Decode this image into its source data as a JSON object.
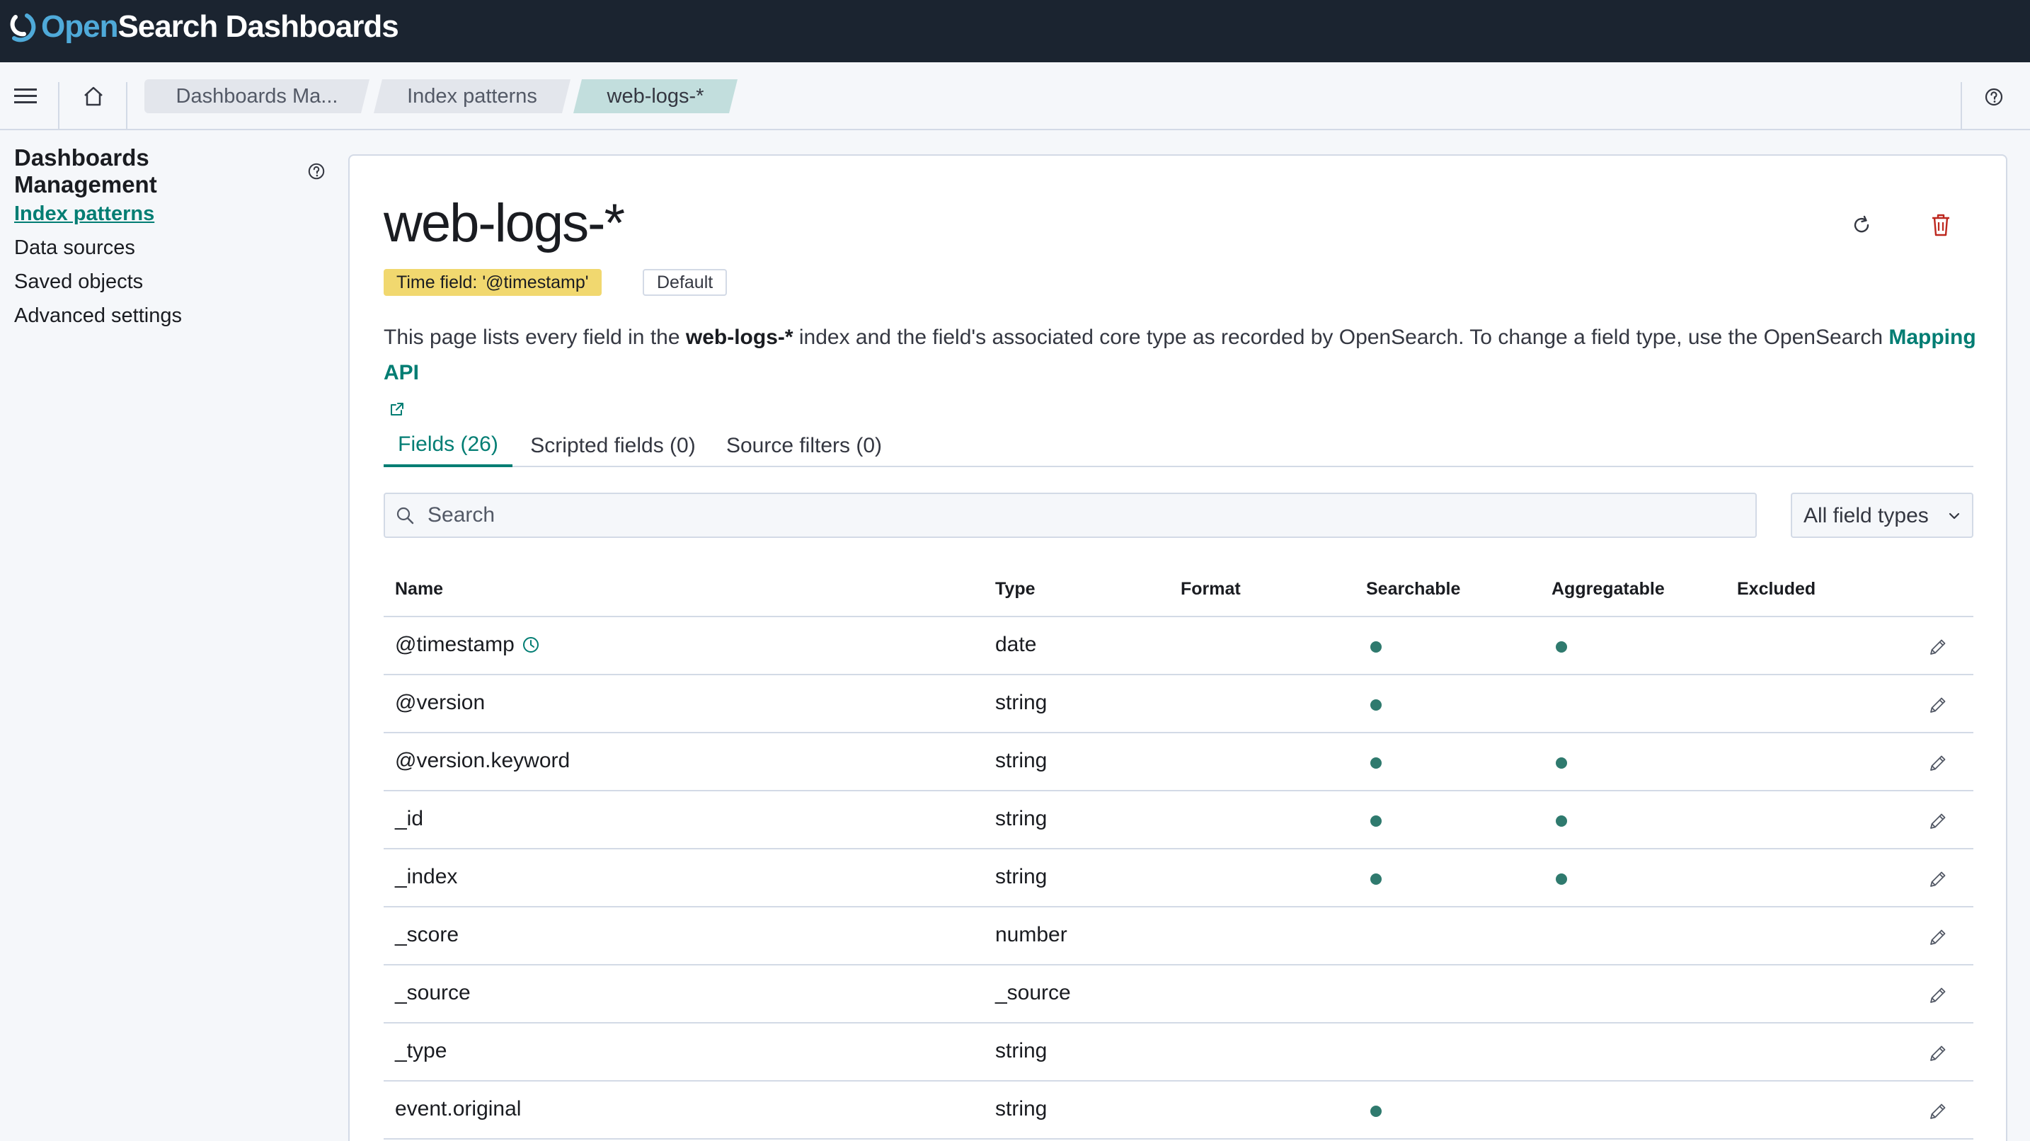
{
  "app": {
    "logo_part1": "Open",
    "logo_part2": "Search Dashboards"
  },
  "breadcrumbs": [
    "Dashboards Ma...",
    "Index patterns",
    "web-logs-*"
  ],
  "sidenav": {
    "title": "Dashboards Management",
    "items": [
      {
        "label": "Index patterns",
        "active": true
      },
      {
        "label": "Data sources",
        "active": false
      },
      {
        "label": "Saved objects",
        "active": false
      },
      {
        "label": "Advanced settings",
        "active": false
      }
    ]
  },
  "page": {
    "title": "web-logs-*",
    "badge_time": "Time field: '@timestamp'",
    "badge_default": "Default",
    "desc_part1": "This page lists every field in the ",
    "desc_bold": "web-logs-*",
    "desc_part2": " index and the field's associated core type as recorded by OpenSearch. To change a field type, use the OpenSearch ",
    "desc_link": "Mapping API"
  },
  "tabs": [
    "Fields (26)",
    "Scripted fields (0)",
    "Source filters (0)"
  ],
  "search": {
    "placeholder": "Search",
    "value": ""
  },
  "filter": {
    "selected": "All field types"
  },
  "table": {
    "headers": {
      "name": "Name",
      "type": "Type",
      "format": "Format",
      "searchable": "Searchable",
      "aggregatable": "Aggregatable",
      "excluded": "Excluded"
    },
    "rows": [
      {
        "name": "@timestamp",
        "type": "date",
        "format": "",
        "searchable": true,
        "aggregatable": true,
        "excluded": false,
        "time_field": true
      },
      {
        "name": "@version",
        "type": "string",
        "format": "",
        "searchable": true,
        "aggregatable": false,
        "excluded": false
      },
      {
        "name": "@version.keyword",
        "type": "string",
        "format": "",
        "searchable": true,
        "aggregatable": true,
        "excluded": false
      },
      {
        "name": "_id",
        "type": "string",
        "format": "",
        "searchable": true,
        "aggregatable": true,
        "excluded": false
      },
      {
        "name": "_index",
        "type": "string",
        "format": "",
        "searchable": true,
        "aggregatable": true,
        "excluded": false
      },
      {
        "name": "_score",
        "type": "number",
        "format": "",
        "searchable": false,
        "aggregatable": false,
        "excluded": false
      },
      {
        "name": "_source",
        "type": "_source",
        "format": "",
        "searchable": false,
        "aggregatable": false,
        "excluded": false
      },
      {
        "name": "_type",
        "type": "string",
        "format": "",
        "searchable": false,
        "aggregatable": false,
        "excluded": false
      },
      {
        "name": "event.original",
        "type": "string",
        "format": "",
        "searchable": true,
        "aggregatable": false,
        "excluded": false
      }
    ]
  },
  "colors": {
    "header_bg": "#1b2430",
    "accent": "#017d73",
    "badge_time": "#f1d86f",
    "active_crumb": "#c2dedd",
    "dot": "#2f7a6e",
    "delete": "#bd271e"
  },
  "icons": {
    "menu": "hamburger-icon",
    "home": "home-icon",
    "help": "help-icon",
    "refresh": "refresh-icon",
    "delete": "trash-icon",
    "external": "external-link-icon",
    "search": "search-icon",
    "chevron": "chevron-down-icon",
    "edit": "pencil-icon",
    "clock": "clock-icon"
  }
}
